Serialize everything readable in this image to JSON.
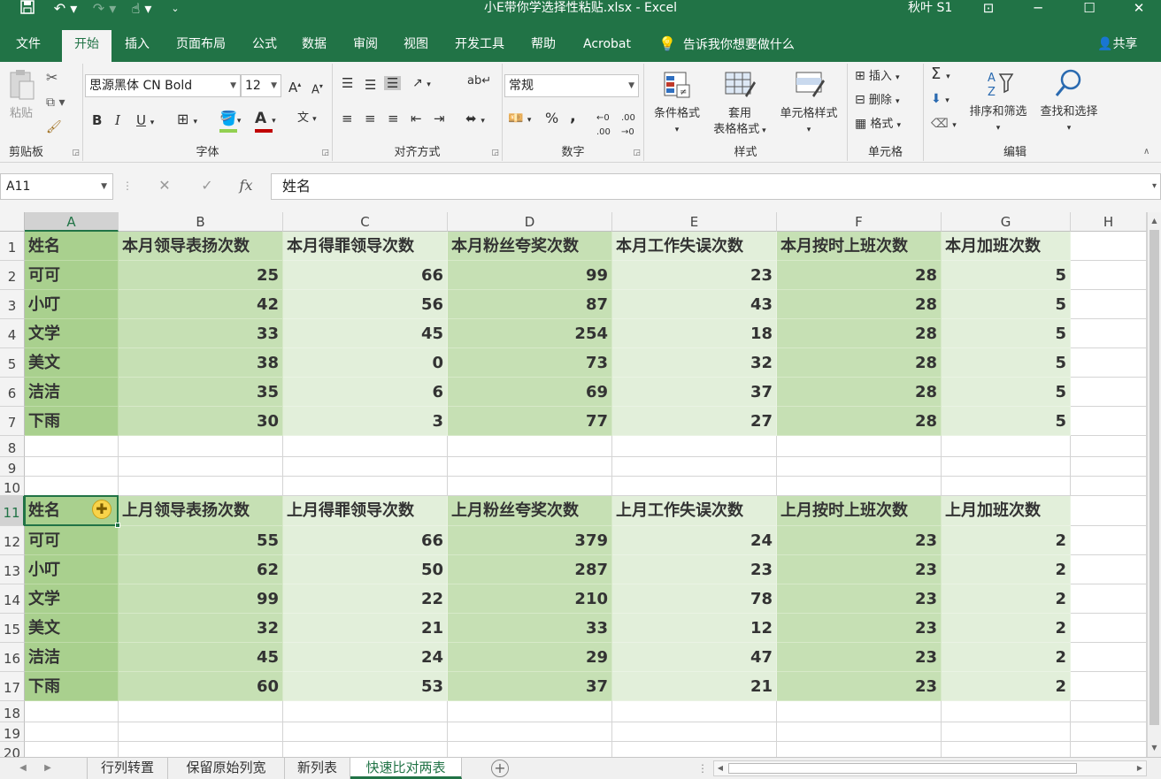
{
  "window": {
    "title": "小E带你学选择性粘贴.xlsx - Excel",
    "user": "秋叶 S1"
  },
  "tabs": [
    "文件",
    "开始",
    "插入",
    "页面布局",
    "公式",
    "数据",
    "审阅",
    "视图",
    "开发工具",
    "帮助",
    "Acrobat"
  ],
  "active_tab": "开始",
  "tell_me": "告诉我你想要做什么",
  "share": "共享",
  "ribbon": {
    "clipboard": {
      "paste": "粘贴",
      "label": "剪贴板"
    },
    "font": {
      "name": "思源黑体 CN Bold",
      "size": "12",
      "label": "字体",
      "bold": "B",
      "italic": "I",
      "underline": "U"
    },
    "alignment": {
      "label": "对齐方式"
    },
    "number": {
      "format": "常规",
      "label": "数字",
      "percent": "%",
      "comma": ","
    },
    "styles": {
      "conditional": "条件格式",
      "table1": "套用",
      "table2": "表格格式",
      "cell_styles": "单元格样式",
      "label": "样式"
    },
    "cells": {
      "insert": "插入",
      "delete": "删除",
      "format": "格式",
      "label": "单元格"
    },
    "editing": {
      "sort": "排序和筛选",
      "find": "查找和选择",
      "label": "编辑"
    }
  },
  "formula_bar": {
    "name_box": "A11",
    "formula": "姓名",
    "fx": "fx"
  },
  "columns": [
    "A",
    "B",
    "C",
    "D",
    "E",
    "F",
    "G",
    "H"
  ],
  "rows": [
    "1",
    "2",
    "3",
    "4",
    "5",
    "6",
    "7",
    "8",
    "9",
    "10",
    "11",
    "12",
    "13",
    "14",
    "15",
    "16",
    "17",
    "18",
    "19",
    "20"
  ],
  "table1": {
    "headers": [
      "姓名",
      "本月领导表扬次数",
      "本月得罪领导次数",
      "本月粉丝夸奖次数",
      "本月工作失误次数",
      "本月按时上班次数",
      "本月加班次数"
    ],
    "rows": [
      [
        "可可",
        "25",
        "66",
        "99",
        "23",
        "28",
        "5"
      ],
      [
        "小叮",
        "42",
        "56",
        "87",
        "43",
        "28",
        "5"
      ],
      [
        "文学",
        "33",
        "45",
        "254",
        "18",
        "28",
        "5"
      ],
      [
        "美文",
        "38",
        "0",
        "73",
        "32",
        "28",
        "5"
      ],
      [
        "洁洁",
        "35",
        "6",
        "69",
        "37",
        "28",
        "5"
      ],
      [
        "下雨",
        "30",
        "3",
        "77",
        "27",
        "28",
        "5"
      ]
    ]
  },
  "table2": {
    "headers": [
      "姓名",
      "上月领导表扬次数",
      "上月得罪领导次数",
      "上月粉丝夸奖次数",
      "上月工作失误次数",
      "上月按时上班次数",
      "上月加班次数"
    ],
    "rows": [
      [
        "可可",
        "55",
        "66",
        "379",
        "24",
        "23",
        "2"
      ],
      [
        "小叮",
        "62",
        "50",
        "287",
        "23",
        "23",
        "2"
      ],
      [
        "文学",
        "99",
        "22",
        "210",
        "78",
        "23",
        "2"
      ],
      [
        "美文",
        "32",
        "21",
        "33",
        "12",
        "23",
        "2"
      ],
      [
        "洁洁",
        "45",
        "24",
        "29",
        "47",
        "23",
        "2"
      ],
      [
        "下雨",
        "60",
        "53",
        "37",
        "21",
        "23",
        "2"
      ]
    ]
  },
  "sheets": [
    "行列转置",
    "保留原始列宽",
    "新列表",
    "快速比对两表"
  ],
  "active_sheet": "快速比对两表",
  "colors": {
    "accent": "#217346",
    "dark_fill": "#a9d08e",
    "mid_fill": "#c6e0b4",
    "light_fill": "#e2efda"
  }
}
